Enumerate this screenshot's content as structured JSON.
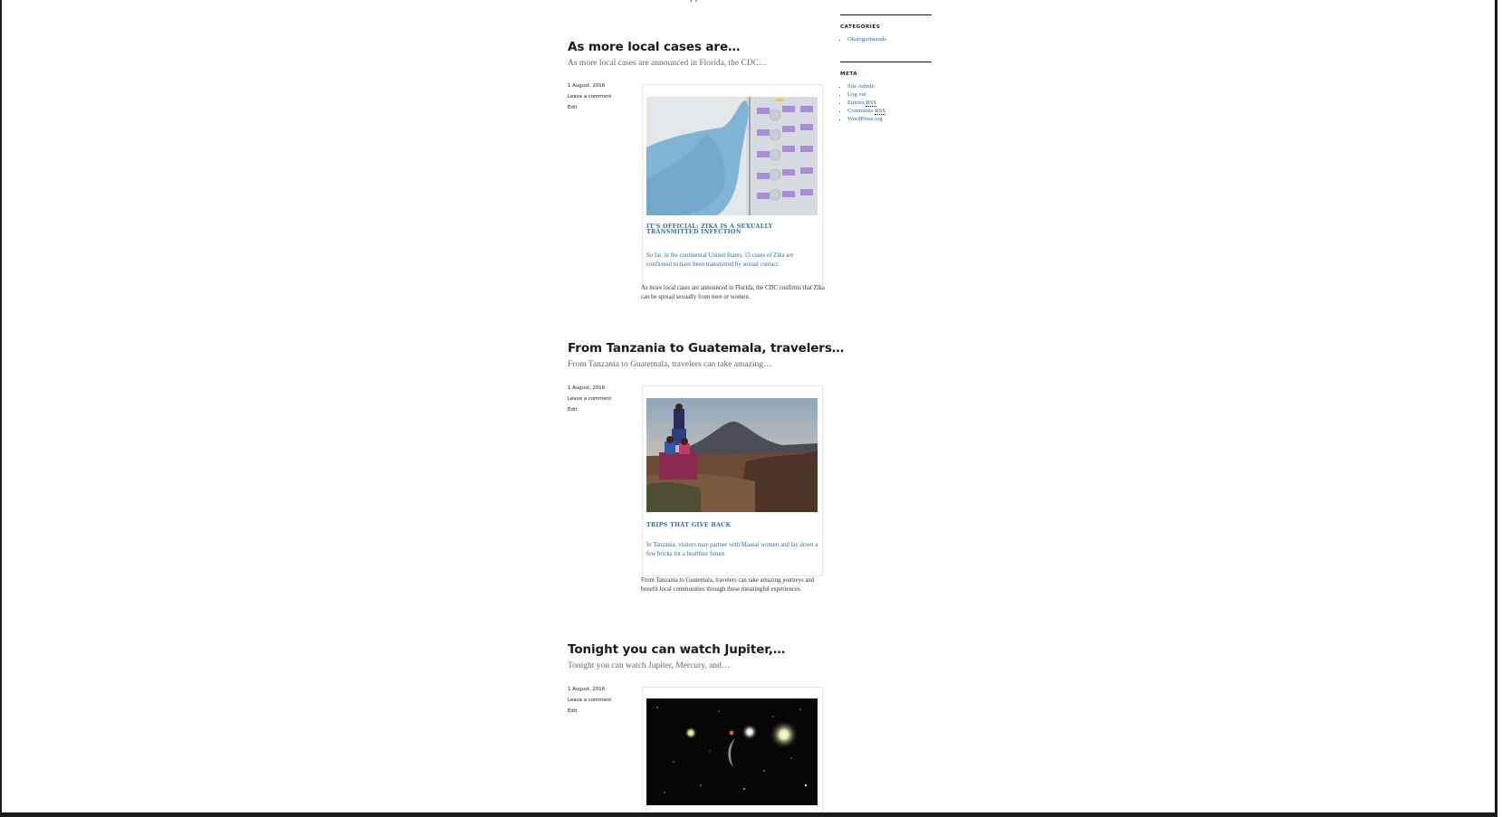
{
  "posts": [
    {
      "title": "As more local cases are…",
      "excerpt": "As more local cases are announced in Florida, the CDC…",
      "date": "1 August, 2016",
      "comment_link": "Leave a comment",
      "edit_link": "Edit",
      "embed": {
        "card_title": "IT’S OFFICIAL: ZIKA IS A SEXUALLY TRANSMITTED INFECTION",
        "card_desc": "So far, in the continental United States, 15 cases of Zika are confirmed to have been transmitted by sexual contact."
      },
      "caption": "As more local cases are announced in Florida, the CDC confirms that Zika can be spread sexually from men or women."
    },
    {
      "title": "From Tanzania to Guatemala, travelers…",
      "excerpt": "From Tanzania to Guatemala, travelers can take amazing…",
      "date": "1 August, 2016",
      "comment_link": "Leave a comment",
      "edit_link": "Edit",
      "embed": {
        "card_title": "TRIPS THAT GIVE BACK",
        "card_desc": "In Tanzania, visitors may partner with Maasai women and lay down a few bricks for a healthier future."
      },
      "caption": "From Tanzania to Guatemala, travelers can take amazing journeys and benefit local communities through these meaningful experiences."
    },
    {
      "title": "Tonight you can watch Jupiter,…",
      "excerpt": "Tonight you can watch Jupiter, Mercury, and…",
      "date": "1 August, 2016",
      "comment_link": "Leave a comment",
      "edit_link": "Edit"
    }
  ],
  "sidebar": {
    "categories": {
      "title": "CATEGORIES",
      "items": [
        "Okategoriserade"
      ]
    },
    "meta": {
      "title": "META",
      "items": {
        "site_admin": "Site Admin",
        "log_out": "Log out",
        "entries_rss_text": "Entries ",
        "entries_rss_abbr": "RSS",
        "comments_rss_text": "Comments ",
        "comments_rss_abbr": "RSS",
        "wordpress": "WordPress.org"
      }
    }
  }
}
